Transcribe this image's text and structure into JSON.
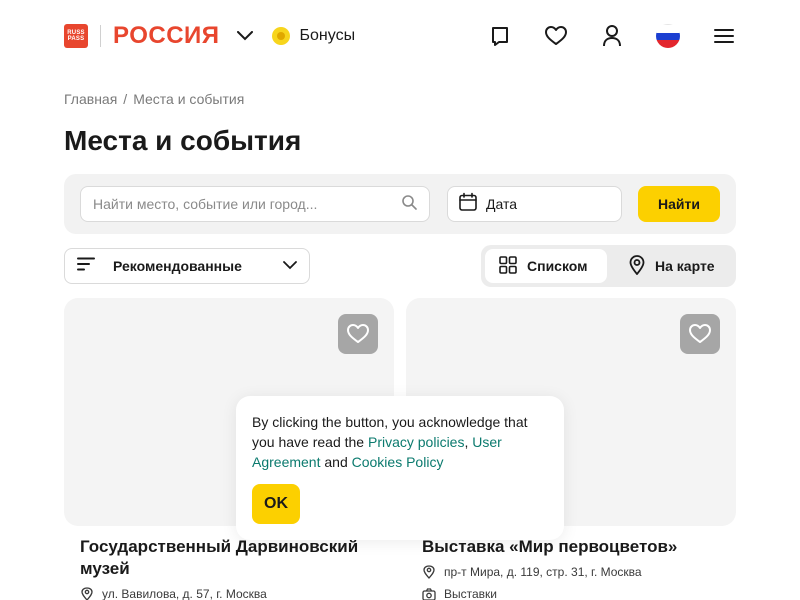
{
  "header": {
    "logo_top": "RUSS",
    "logo_bottom": "PASS",
    "logo_text": "РОССИЯ",
    "bonus_label": "Бонусы",
    "icons": [
      "bookmark-icon",
      "heart-icon",
      "user-icon",
      "russia-flag-icon",
      "menu-icon"
    ]
  },
  "breadcrumb": {
    "home": "Главная",
    "separator": "/",
    "current": "Места и события"
  },
  "page_title": "Места и события",
  "search": {
    "placeholder": "Найти место, событие или город...",
    "date_label": "Дата",
    "submit_label": "Найти"
  },
  "sort": {
    "selected": "Рекомендованные"
  },
  "view_toggle": {
    "list_label": "Списком",
    "map_label": "На карте",
    "active": "list"
  },
  "cards": [
    {
      "title": "Государственный Дарвиновский музей",
      "address": "ул. Вавилова, д. 57, г. Москва"
    },
    {
      "title": "Выставка «Мир первоцветов»",
      "address": "пр-т Мира, д. 119, стр. 31, г. Москва",
      "category": "Выставки"
    }
  ],
  "cookie": {
    "text_before": "By clicking the button, you acknowledge that you have read the ",
    "privacy_link": "Privacy policies",
    "comma": ", ",
    "user_agreement_link": "User Agreement",
    "and": " and ",
    "cookies_link": "Cookies Policy",
    "ok_label": "OK"
  },
  "colors": {
    "brand_red": "#e8462e",
    "accent_yellow": "#fcd000",
    "link_teal": "#0b7a6e"
  }
}
